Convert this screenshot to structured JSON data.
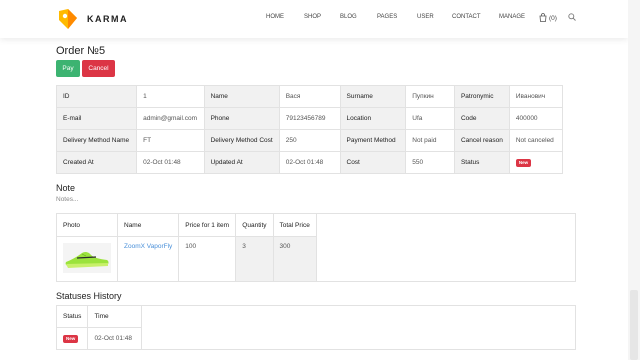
{
  "header": {
    "brand": "KARMA",
    "nav": [
      "HOME",
      "SHOP",
      "BLOG",
      "PAGES",
      "USER",
      "CONTACT",
      "MANAGE"
    ],
    "cart_count": "(0)",
    "accent": "#f5a623"
  },
  "order": {
    "title": "Order №5",
    "pay_label": "Pay",
    "cancel_label": "Cancel"
  },
  "info_rows": [
    [
      [
        "ID",
        "1"
      ],
      [
        "Name",
        "Вася"
      ],
      [
        "Surname",
        "Пупкин"
      ],
      [
        "Patronymic",
        "Иванович"
      ]
    ],
    [
      [
        "E-mail",
        "admin@gmail.com"
      ],
      [
        "Phone",
        "79123456789"
      ],
      [
        "Location",
        "Ufa"
      ],
      [
        "Code",
        "400000"
      ]
    ],
    [
      [
        "Delivery Method Name",
        "FT"
      ],
      [
        "Delivery Method Cost",
        "250"
      ],
      [
        "Payment Method",
        "Not paid"
      ],
      [
        "Cancel reason",
        "Not canceled"
      ]
    ],
    [
      [
        "Created At",
        "02-Oct 01:48"
      ],
      [
        "Updated At",
        "02-Oct 01:48"
      ],
      [
        "Cost",
        "550"
      ],
      [
        "Status",
        "__badge__"
      ]
    ]
  ],
  "status_badge": "New",
  "note": {
    "title": "Note",
    "text": "Notes..."
  },
  "items": {
    "headers": [
      "Photo",
      "Name",
      "Price for 1 item",
      "Quantity",
      "Total Price"
    ],
    "rows": [
      {
        "image": "green-sneaker",
        "name": "ZoomX VaporFly",
        "price": "100",
        "quantity": "3",
        "total": "300"
      }
    ]
  },
  "history": {
    "title": "Statuses History",
    "headers": [
      "Status",
      "Time"
    ],
    "rows": [
      {
        "status": "New",
        "time": "02-Oct 01:48"
      }
    ]
  }
}
